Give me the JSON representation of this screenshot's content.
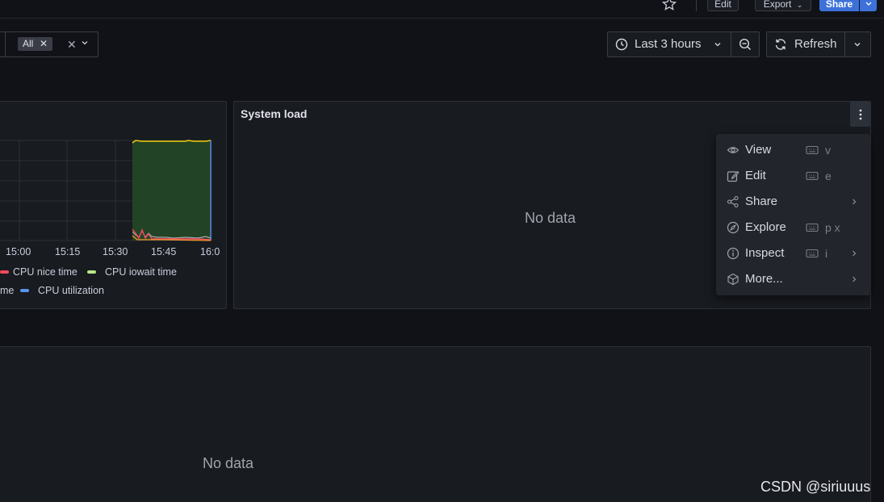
{
  "header": {
    "edit_label": "Edit",
    "export_label": "Export",
    "share_label": "Share"
  },
  "filter": {
    "chip_label": "All"
  },
  "time": {
    "range_label": "Last 3 hours",
    "refresh_label": "Refresh"
  },
  "panels": {
    "load_title": "System load",
    "load_empty": "No data",
    "bottom_empty": "No data"
  },
  "menu": {
    "items": [
      {
        "label": "View",
        "icon": "eye-icon",
        "shortcut": "v",
        "submenu": false
      },
      {
        "label": "Edit",
        "icon": "edit-icon",
        "shortcut": "e",
        "submenu": false
      },
      {
        "label": "Share",
        "icon": "share-icon",
        "shortcut": "",
        "submenu": true
      },
      {
        "label": "Explore",
        "icon": "compass-icon",
        "shortcut": "p x",
        "submenu": false
      },
      {
        "label": "Inspect",
        "icon": "info-icon",
        "shortcut": "i",
        "submenu": true
      },
      {
        "label": "More...",
        "icon": "cube-icon",
        "shortcut": "",
        "submenu": true
      }
    ]
  },
  "legend": [
    {
      "label": "CPU nice time",
      "color": "#f2495c"
    },
    {
      "label": "CPU iowait time",
      "color": "#b8e986"
    },
    {
      "label": "me",
      "color": "#a8a8a8"
    },
    {
      "label": "CPU utilization",
      "color": "#5794f2"
    }
  ],
  "chart_data": {
    "type": "area",
    "x_ticks": [
      "15:00",
      "15:15",
      "15:30",
      "15:45",
      "16:0"
    ],
    "series_colors": {
      "yellow": "#f2cc0c",
      "green": "#73bf69",
      "red": "#f2495c",
      "blue": "#5794f2"
    },
    "grid": true
  },
  "watermark": "CSDN @siriuuus"
}
